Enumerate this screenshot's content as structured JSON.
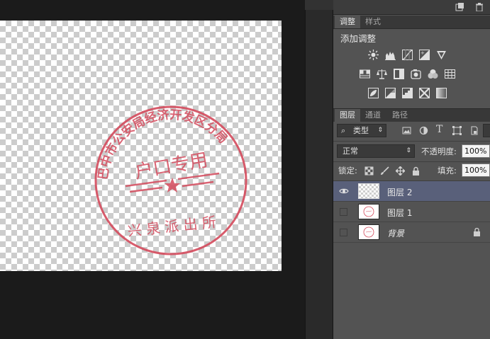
{
  "panels": {
    "adjustments_tabs": [
      "调整",
      "样式"
    ],
    "adjustments_title": "添加调整",
    "layers_tabs": [
      "图层",
      "通道",
      "路径"
    ]
  },
  "layers_controls": {
    "filter_kind": "类型",
    "blend_mode": "正常",
    "opacity_label": "不透明度:",
    "opacity_value": "100%",
    "lock_label": "锁定:",
    "fill_label": "填充:",
    "fill_value": "100%"
  },
  "layers": [
    {
      "name": "图层 2",
      "visible": true,
      "selected": true
    },
    {
      "name": "图层 1",
      "visible": false,
      "selected": false
    },
    {
      "name": "背景",
      "visible": false,
      "selected": false,
      "locked": true
    }
  ],
  "stamp": {
    "arc_text": "巴中市公安局经济开发区分局",
    "center_text": "户口专用",
    "bottom_text": "兴 泉 派 出 所",
    "color": "#d44a5c"
  },
  "colors": {
    "panel_bg": "#535353",
    "selected_layer": "#59607a",
    "canvas_bg": "#1b1b1b"
  },
  "icons": {
    "top_bar": [
      "new-layer-icon",
      "trash-icon"
    ],
    "adjustments": [
      "brightness-icon",
      "levels-icon",
      "curves-icon",
      "exposure-icon",
      "vibrance-icon",
      "hue-saturation-icon",
      "color-balance-icon",
      "black-white-icon",
      "photo-filter-icon",
      "channel-mixer-icon",
      "color-lookup-icon",
      "invert-icon",
      "posterize-icon",
      "threshold-icon",
      "selective-color-icon",
      "gradient-map-icon"
    ]
  }
}
